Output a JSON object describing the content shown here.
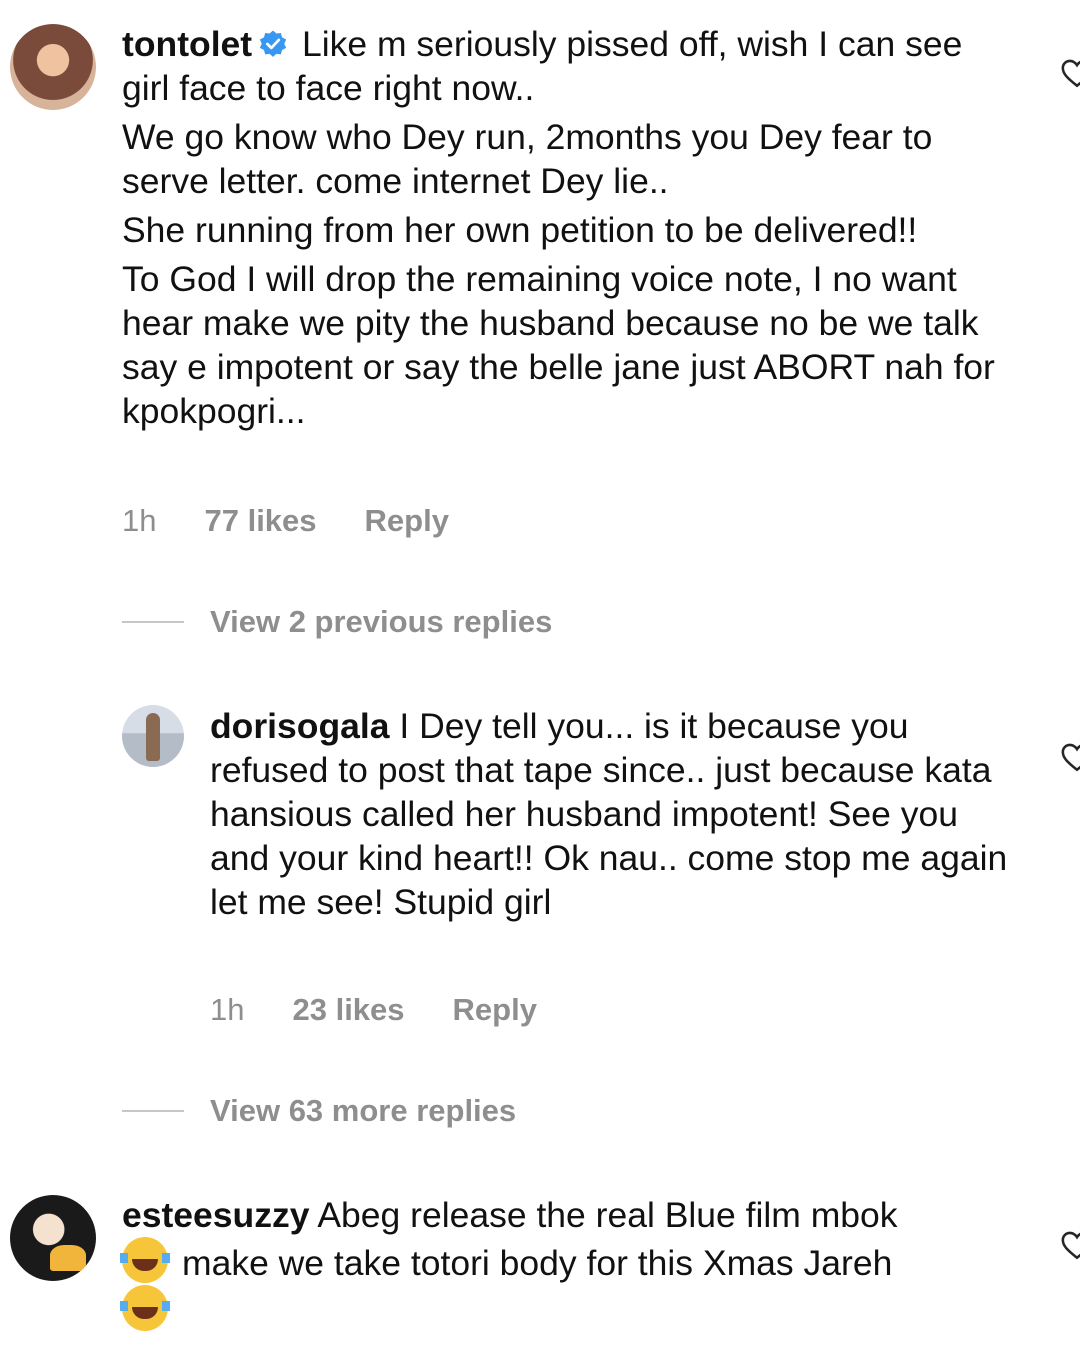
{
  "comments": [
    {
      "username": "tontolet",
      "verified": true,
      "paragraphs": [
        "Like m seriously pissed off, wish I can see girl face to face right now..",
        "We go know who Dey run, 2months you Dey fear to serve letter. come internet Dey lie..",
        "She running from her own petition to be delivered!!",
        "To God I will drop the remaining voice note, I no want hear make we pity the husband because no be we talk say e impotent or say the belle jane just ABORT nah for kpokpogri..."
      ],
      "time": "1h",
      "likes": "77 likes",
      "reply_label": "Reply",
      "view_replies": "View 2 previous replies"
    },
    {
      "username": "dorisogala",
      "text": "I Dey tell you... is it because you refused to post that tape since.. just because kata hansious called her husband impotent! See you and your kind heart!! Ok nau.. come stop me again let me see! Stupid girl",
      "time": "1h",
      "likes": "23 likes",
      "reply_label": "Reply",
      "view_replies": "View 63 more replies"
    },
    {
      "username": "esteesuzzy",
      "text_1": "Abeg release the real Blue film mbok",
      "text_2": "make we take totori body for this Xmas Jareh"
    }
  ],
  "icons": {
    "verified": "verified-badge-icon",
    "like": "heart-outline-icon",
    "emoji": "face-with-tears-of-joy-emoji"
  },
  "colors": {
    "text": "#111111",
    "meta": "#8e8e8e",
    "verified": "#3897f0"
  }
}
